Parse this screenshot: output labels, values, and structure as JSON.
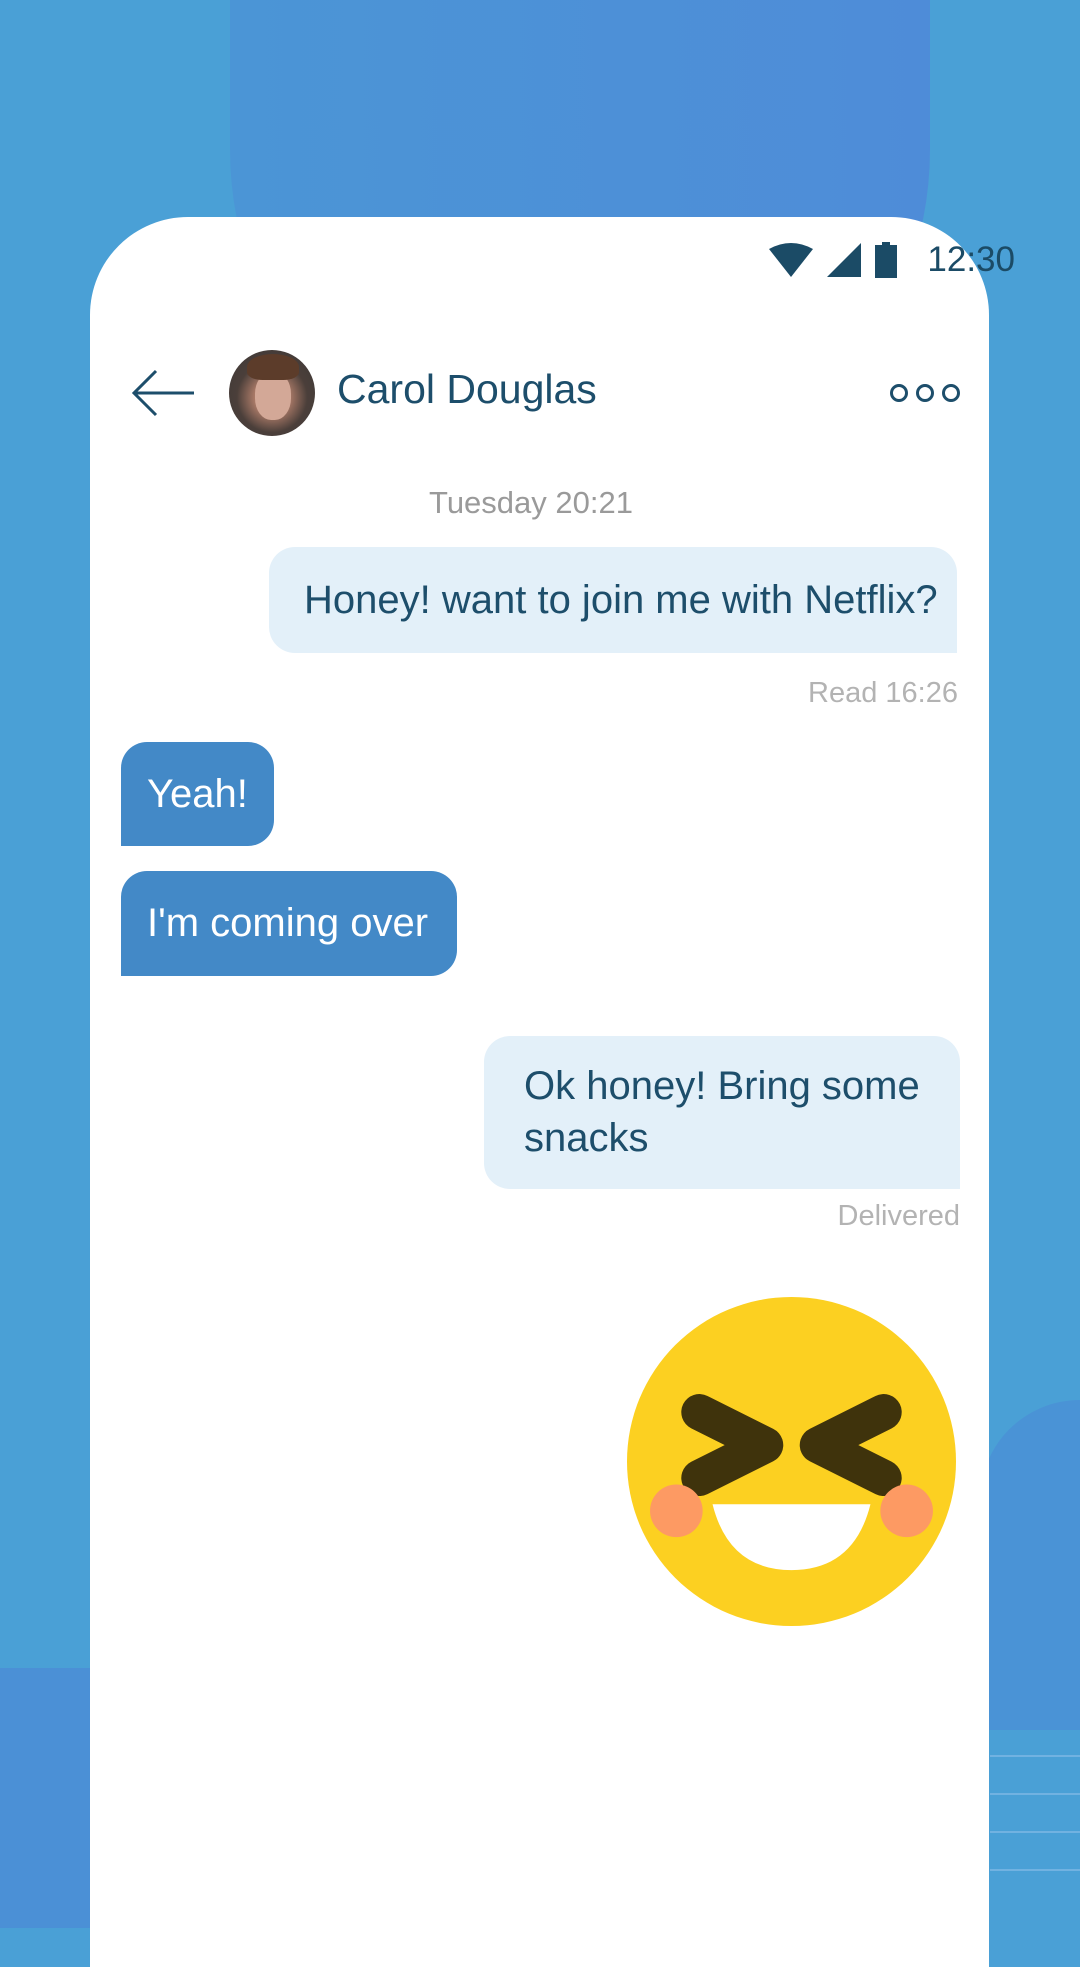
{
  "status_bar": {
    "time": "12:30",
    "icons": [
      "wifi-icon",
      "cellular-signal-icon",
      "battery-icon"
    ]
  },
  "header": {
    "contact_name": "Carol Douglas",
    "back_icon": "arrow-left-icon",
    "menu_icon": "more-options-icon"
  },
  "conversation": {
    "timestamp": "Tuesday  20:21",
    "messages": [
      {
        "direction": "outgoing",
        "text": "Honey! want to join me with Netflix?",
        "status": "Read 16:26"
      },
      {
        "direction": "incoming",
        "text": "Yeah!"
      },
      {
        "direction": "incoming",
        "text": "I'm coming over"
      },
      {
        "direction": "outgoing",
        "text": "Ok honey! Bring some snacks",
        "status": "Delivered"
      },
      {
        "direction": "outgoing",
        "sticker": "laughing-face-emoji"
      }
    ]
  },
  "colors": {
    "background": "#4aa0d6",
    "incoming_bubble": "#4389c7",
    "outgoing_bubble": "#e3f0f9",
    "text_dark": "#1d4e6b",
    "emoji_yellow": "#fcd021"
  }
}
